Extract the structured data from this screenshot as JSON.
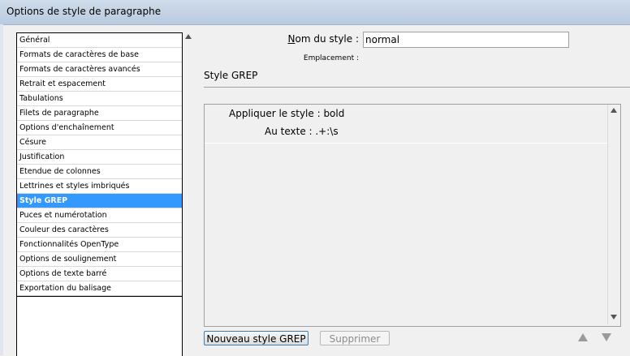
{
  "window": {
    "title": "Options de style de paragraphe"
  },
  "sidebar": {
    "items": [
      "Général",
      "Formats de caractères de base",
      "Formats de caractères avancés",
      "Retrait et espacement",
      "Tabulations",
      "Filets de paragraphe",
      "Options d'enchaînement",
      "Césure",
      "Justification",
      "Etendue de colonnes",
      "Lettrines et styles imbriqués",
      "Style GREP",
      "Puces et numérotation",
      "Couleur des caractères",
      "Fonctionnalités OpenType",
      "Options de soulignement",
      "Options de texte barré",
      "Exportation du balisage"
    ],
    "selected_index": 11
  },
  "form": {
    "name_label_prefix": "N",
    "name_label_rest": "om du style :",
    "name_value": "normal",
    "location_label": "Emplacement :"
  },
  "grep": {
    "section_title": "Style GREP",
    "apply_style_text": "Appliquer le style : bold",
    "to_text_text": "Au texte : .+:\\s"
  },
  "buttons": {
    "new_grep": "Nouveau style GREP",
    "delete": "Supprimer"
  },
  "colors": {
    "selection": "#3399ff"
  }
}
